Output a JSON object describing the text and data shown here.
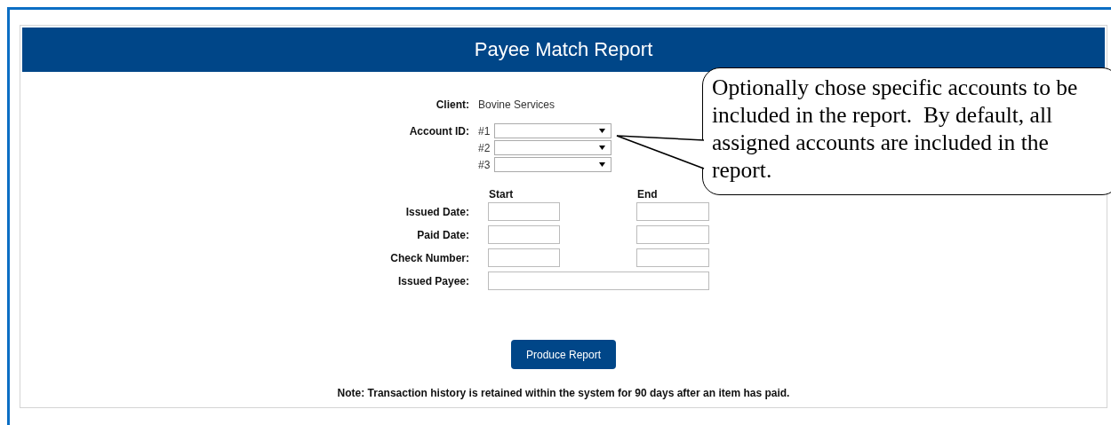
{
  "header": {
    "title": "Payee Match Report"
  },
  "client": {
    "label": "Client:",
    "value": "Bovine Services"
  },
  "account_id": {
    "label": "Account ID:",
    "selects": [
      {
        "label": "#1"
      },
      {
        "label": "#2"
      },
      {
        "label": "#3"
      }
    ]
  },
  "range_columns": [
    "Start",
    "End"
  ],
  "fields": [
    {
      "label": "Issued Date:",
      "kind": "range"
    },
    {
      "label": "Paid Date:",
      "kind": "range"
    },
    {
      "label": "Check Number:",
      "kind": "range"
    },
    {
      "label": "Issued Payee:",
      "kind": "single"
    }
  ],
  "button": "Produce Report",
  "note": "Note: Transaction history is retained within the system for 90 days after an item has paid.",
  "callout": {
    "text": "Optionally chose specific accounts to be included in the report.  By default, all assigned accounts are included in the report."
  }
}
